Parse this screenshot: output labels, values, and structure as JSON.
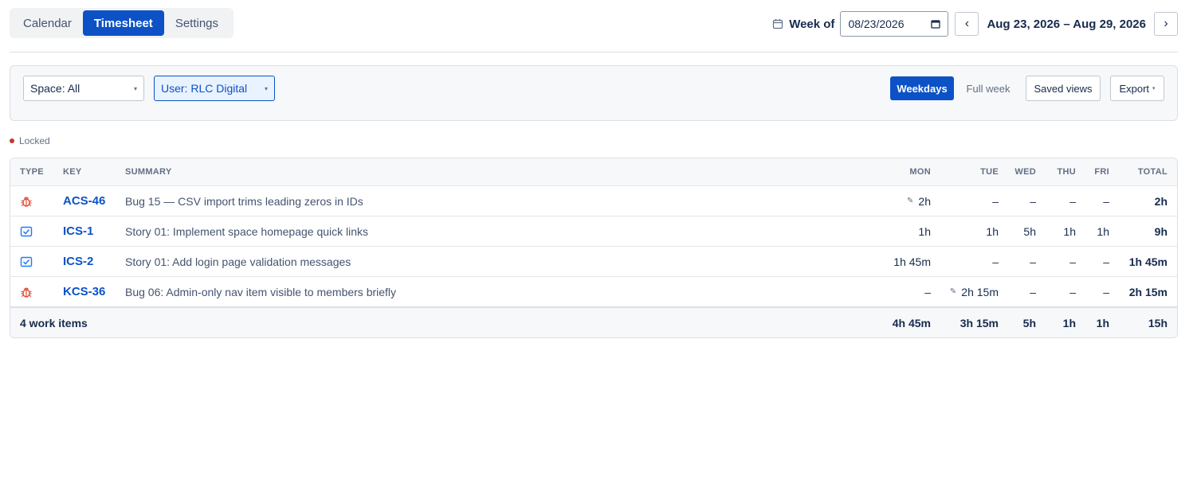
{
  "tabs": [
    {
      "label": "Calendar",
      "active": false
    },
    {
      "label": "Timesheet",
      "active": true
    },
    {
      "label": "Settings",
      "active": false
    }
  ],
  "week": {
    "label": "Week of",
    "date_value": "08/23/2026",
    "prev": "‹",
    "next": "›",
    "range": "Aug 23, 2026 – Aug 29, 2026"
  },
  "filters": {
    "space": "Space: All",
    "user": "User: RLC Digital",
    "weekdays": "Weekdays",
    "full_week": "Full week",
    "saved_views": "Saved views",
    "export": "Export"
  },
  "legend": {
    "locked": "Locked"
  },
  "table": {
    "headers": {
      "type": "TYPE",
      "key": "KEY",
      "summary": "SUMMARY",
      "mon": "MON",
      "tue": "TUE",
      "wed": "WED",
      "thu": "THU",
      "fri": "FRI",
      "total": "TOTAL"
    },
    "rows": [
      {
        "type": "bug",
        "key": "ACS-46",
        "summary": "Bug 15 — CSV import trims leading zeros in IDs",
        "mon": "2h",
        "tue": "–",
        "wed": "–",
        "thu": "–",
        "fri": "–",
        "total": "2h",
        "edited": "mon"
      },
      {
        "type": "story",
        "key": "ICS-1",
        "summary": "Story 01: Implement space homepage quick links",
        "mon": "1h",
        "tue": "1h",
        "wed": "5h",
        "thu": "1h",
        "fri": "1h",
        "total": "9h",
        "edited": ""
      },
      {
        "type": "story",
        "key": "ICS-2",
        "summary": "Story 01: Add login page validation messages",
        "mon": "1h 45m",
        "tue": "–",
        "wed": "–",
        "thu": "–",
        "fri": "–",
        "total": "1h 45m",
        "edited": ""
      },
      {
        "type": "bug",
        "key": "KCS-36",
        "summary": "Bug 06: Admin-only nav item visible to members briefly",
        "mon": "–",
        "tue": "2h 15m",
        "wed": "–",
        "thu": "–",
        "fri": "–",
        "total": "2h 15m",
        "edited": "tue"
      }
    ],
    "footer": {
      "label": "4 work items",
      "mon": "4h 45m",
      "tue": "3h 15m",
      "wed": "5h",
      "thu": "1h",
      "fri": "1h",
      "total": "15h"
    }
  },
  "colors": {
    "accent": "#0c52c6",
    "bug": "#e34935",
    "story": "#1d7afc",
    "locked": "#c9372c"
  }
}
